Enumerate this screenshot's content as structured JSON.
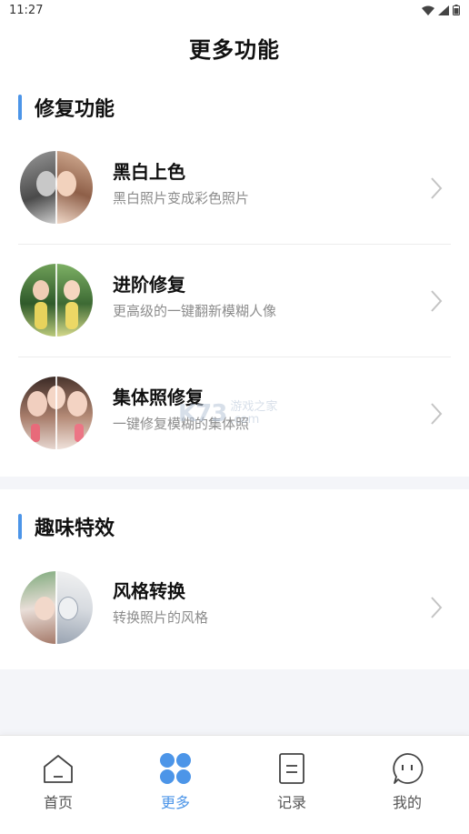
{
  "status_bar": {
    "time": "11:27"
  },
  "header": {
    "title": "更多功能"
  },
  "sections": [
    {
      "title": "修复功能",
      "items": [
        {
          "title": "黑白上色",
          "subtitle": "黑白照片变成彩色照片"
        },
        {
          "title": "进阶修复",
          "subtitle": "更高级的一键翻新模糊人像"
        },
        {
          "title": "集体照修复",
          "subtitle": "一键修复模糊的集体照"
        }
      ]
    },
    {
      "title": "趣味特效",
      "items": [
        {
          "title": "风格转换",
          "subtitle": "转换照片的风格"
        }
      ]
    }
  ],
  "watermark": {
    "logo": "K73",
    "line1": "游戏之家",
    "line2": ".com"
  },
  "tab_bar": {
    "tabs": [
      {
        "label": "首页",
        "icon": "home-icon"
      },
      {
        "label": "更多",
        "icon": "grid-icon",
        "active": true
      },
      {
        "label": "记录",
        "icon": "document-icon"
      },
      {
        "label": "我的",
        "icon": "profile-icon"
      }
    ]
  },
  "colors": {
    "accent": "#4c95e8",
    "background": "#f4f5f9",
    "text_secondary": "#8c8c8c"
  }
}
